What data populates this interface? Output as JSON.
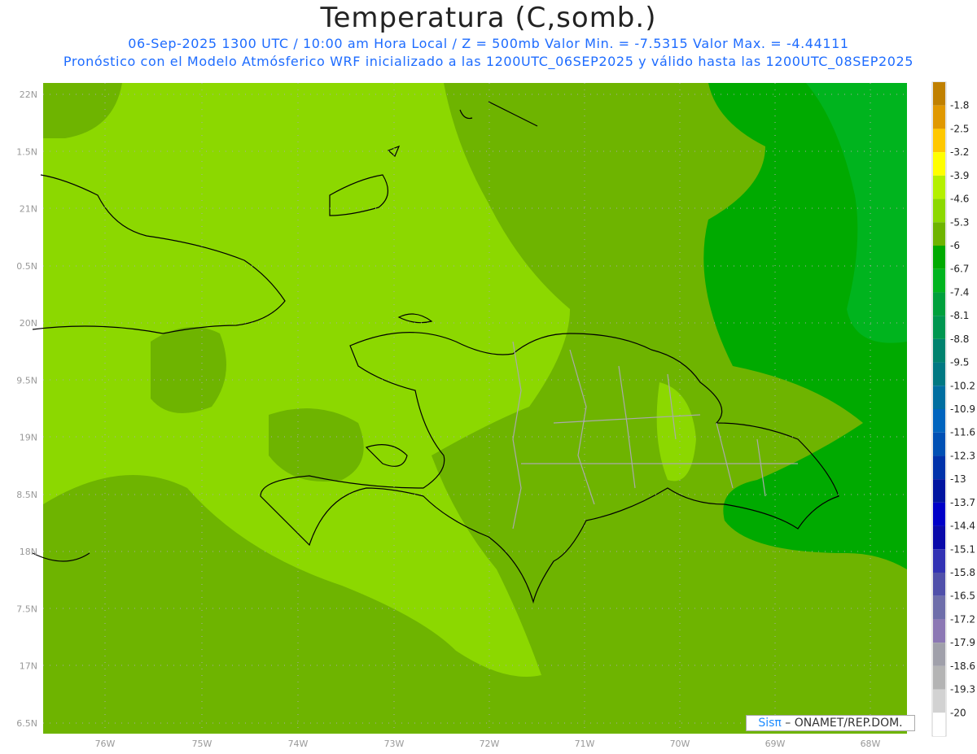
{
  "title": "Temperatura (C,somb.)",
  "subtitle1": "06-Sep-2025  1300 UTC / 10:00 am Hora Local / Z = 500mb  Valor Min. = -7.5315  Valor Max. = -4.44111",
  "subtitle2": "Pronóstico con el Modelo Atmósferico WRF inicializado a las 1200UTC_06SEP2025 y válido hasta las  1200UTC_08SEP2025",
  "lon_labels": [
    "76W",
    "75W",
    "74W",
    "73W",
    "72W",
    "71W",
    "70W",
    "69W",
    "68W"
  ],
  "lat_labels": [
    "22N",
    "1.5N",
    "21N",
    "0.5N",
    "20N",
    "9.5N",
    "19N",
    "8.5N",
    "18N",
    "7.5N",
    "17N",
    "6.5N"
  ],
  "colorbar": {
    "labels": [
      "-1.8",
      "-2.5",
      "-3.2",
      "-3.9",
      "-4.6",
      "-5.3",
      "-6",
      "-6.7",
      "-7.4",
      "-8.1",
      "-8.8",
      "-9.5",
      "-10.2",
      "-10.9",
      "-11.6",
      "-12.3",
      "-13",
      "-13.7",
      "-14.4",
      "-15.1",
      "-15.8",
      "-16.5",
      "-17.2",
      "-17.9",
      "-18.6",
      "-19.3",
      "-20"
    ],
    "colors": [
      "#c08000",
      "#e09800",
      "#ffc800",
      "#ffff00",
      "#b4f000",
      "#8cd800",
      "#6eb400",
      "#00aa00",
      "#00b41e",
      "#00a03c",
      "#009650",
      "#00826e",
      "#007882",
      "#006ea0",
      "#0064be",
      "#0050b4",
      "#0032aa",
      "#0014a0",
      "#0000c8",
      "#0a0aaa",
      "#3232b4",
      "#5050aa",
      "#6e6eaa",
      "#8c78b4",
      "#a0a0aa",
      "#b4b4b4",
      "#d2d2d2",
      "#ffffff"
    ]
  },
  "credit": {
    "brand": "Sisπ",
    "text": " – ONAMET/REP.DOM."
  }
}
